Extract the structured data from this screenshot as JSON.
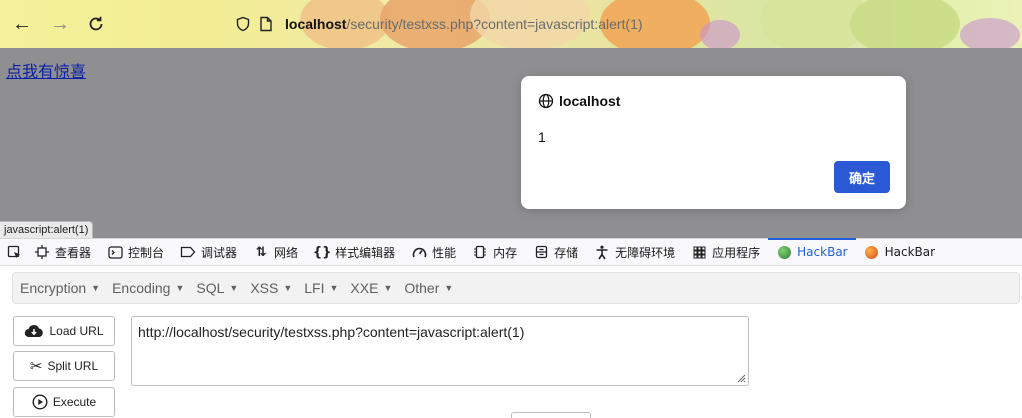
{
  "browser": {
    "url_host": "localhost",
    "url_path": "/security/testxss.php?content=javascript:alert(1)",
    "icons": [
      "back-arrow-icon",
      "forward-arrow-icon",
      "reload-icon",
      "shield-icon",
      "page-icon"
    ]
  },
  "page": {
    "link_text": "点我有惊喜",
    "status_tooltip": "javascript:alert(1)"
  },
  "dialog": {
    "origin": "localhost",
    "message": "1",
    "ok_label": "确定"
  },
  "devtools": {
    "tabs": [
      {
        "label": "查看器",
        "icon": "inspector-icon"
      },
      {
        "label": "控制台",
        "icon": "console-icon"
      },
      {
        "label": "调试器",
        "icon": "debugger-icon"
      },
      {
        "label": "网络",
        "icon": "network-icon"
      },
      {
        "label": "样式编辑器",
        "icon": "style-editor-icon"
      },
      {
        "label": "性能",
        "icon": "performance-icon"
      },
      {
        "label": "内存",
        "icon": "memory-icon"
      },
      {
        "label": "存储",
        "icon": "storage-icon"
      },
      {
        "label": "无障碍环境",
        "icon": "accessibility-icon"
      },
      {
        "label": "应用程序",
        "icon": "application-icon"
      },
      {
        "label": "HackBar",
        "icon": "hackbar-icon",
        "active": true
      },
      {
        "label": "HackBar",
        "icon": "hackbar-icon"
      }
    ],
    "active_color": "#1f5fd6"
  },
  "hackbar": {
    "menu": [
      "Encryption",
      "Encoding",
      "SQL",
      "XSS",
      "LFI",
      "XXE",
      "Other"
    ],
    "buttons": {
      "load": "Load URL",
      "split": "Split URL",
      "execute": "Execute"
    },
    "url_value": "http://localhost/security/testxss.php?content=javascript:alert(1)"
  },
  "colors": {
    "dialog_button": "#2b59d6",
    "link": "#0b1fa6",
    "overlay": "#8f8f91"
  }
}
